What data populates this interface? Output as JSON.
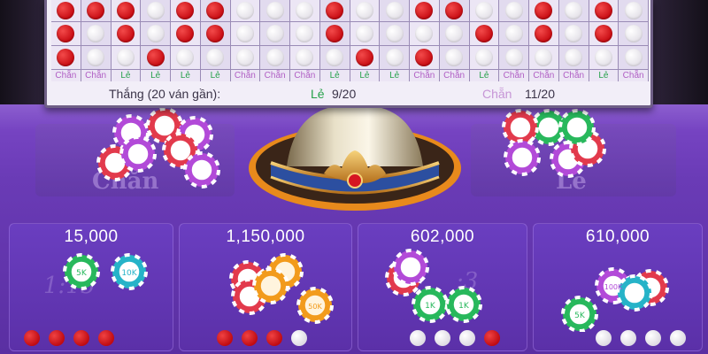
{
  "board": {
    "rows": [
      [
        "red",
        "red",
        "red",
        "white",
        "red",
        "red",
        "white",
        "white",
        "white",
        "red",
        "white",
        "white",
        "red",
        "red",
        "white",
        "white",
        "red",
        "white",
        "red",
        "white"
      ],
      [
        "red",
        "white",
        "red",
        "white",
        "red",
        "red",
        "white",
        "white",
        "white",
        "red",
        "white",
        "white",
        "white",
        "white",
        "red",
        "white",
        "red",
        "white",
        "red",
        "white"
      ],
      [
        "red",
        "white",
        "white",
        "red",
        "white",
        "white",
        "white",
        "white",
        "white",
        "white",
        "red",
        "white",
        "red",
        "white",
        "white",
        "white",
        "white",
        "white",
        "white",
        "white"
      ]
    ],
    "labels": [
      "Chẵn",
      "Chẵn",
      "Lẻ",
      "Lẻ",
      "Lẻ",
      "Lẻ",
      "Chẵn",
      "Chẵn",
      "Chẵn",
      "Lẻ",
      "Lẻ",
      "Lẻ",
      "Chẵn",
      "Chẵn",
      "Lẻ",
      "Chẵn",
      "Chẵn",
      "Chẵn",
      "Lẻ",
      "Chẵn"
    ],
    "summary_title": "Thắng (20 ván gần):",
    "le_label": "Lẻ",
    "le_value": "9/20",
    "chan_label": "Chẵn",
    "chan_value": "11/20"
  },
  "areas": {
    "chan_label": "Chẵn",
    "le_label": "Lẻ"
  },
  "bets": [
    {
      "amount": "15,000",
      "odds": "1:15",
      "pattern": [
        "red",
        "red",
        "red",
        "red"
      ]
    },
    {
      "amount": "1,150,000",
      "odds": "",
      "pattern": [
        "red",
        "red",
        "red",
        "white"
      ]
    },
    {
      "amount": "602,000",
      "odds": ":3",
      "pattern": [
        "white",
        "white",
        "white",
        "red"
      ]
    },
    {
      "amount": "610,000",
      "odds": "",
      "pattern": [
        "white",
        "white",
        "white",
        "white"
      ]
    }
  ],
  "chip_labels": [
    "5K",
    "10K",
    "50K",
    "100K",
    "1K"
  ],
  "colors": {
    "table": "#6a3bb6",
    "chan": "#b05ec4",
    "le": "#26a14a",
    "red_dot": "#d0101a"
  }
}
